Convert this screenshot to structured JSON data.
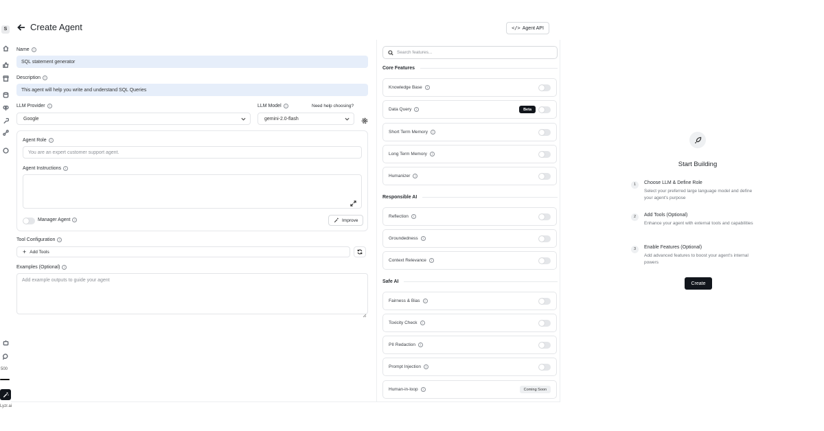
{
  "rail": {
    "logo": "S",
    "credits": "500",
    "brand": "Lyzr.ai"
  },
  "header": {
    "title": "Create Agent",
    "api_button": "Agent API",
    "api_icon": "</>"
  },
  "form": {
    "name_label": "Name",
    "name_value": "SQL statement generator",
    "description_label": "Description",
    "description_value": "This agent will help you write and understand SQL Queries",
    "provider_label": "LLM Provider",
    "provider_value": "Google",
    "model_label": "LLM Model",
    "model_value": "gemini-2.0-flash",
    "help_link": "Need help choosing?",
    "role_label": "Agent Role",
    "role_placeholder": "You are an expert customer support agent.",
    "instructions_label": "Agent Instructions",
    "instructions_placeholder": "",
    "manager_label": "Manager Agent",
    "improve_button": "Improve",
    "tool_label": "Tool Configuration",
    "add_tools_button": "Add Tools",
    "examples_label": "Examples (Optional)",
    "examples_placeholder": "Add example outputs to guide your agent"
  },
  "features": {
    "search_placeholder": "Search features...",
    "core_title": "Core Features",
    "core": [
      {
        "label": "Knowledge Base",
        "enabled": false
      },
      {
        "label": "Data Query",
        "badge": "Beta",
        "enabled": false
      },
      {
        "label": "Short Term Memory",
        "enabled": false
      },
      {
        "label": "Long Term Memory",
        "enabled": false
      },
      {
        "label": "Humanizer",
        "enabled": false
      }
    ],
    "responsible_title": "Responsible AI",
    "responsible": [
      {
        "label": "Reflection",
        "enabled": false
      },
      {
        "label": "Groundedness",
        "enabled": false
      },
      {
        "label": "Context Relevance",
        "enabled": false
      }
    ],
    "safe_title": "Safe AI",
    "safe": [
      {
        "label": "Fairness & Bias",
        "enabled": false
      },
      {
        "label": "Toxicity Check",
        "enabled": false
      },
      {
        "label": "PII Redaction",
        "enabled": false
      },
      {
        "label": "Prompt Injection",
        "enabled": false
      },
      {
        "label": "Human-in-loop",
        "badge": "Coming Soon"
      }
    ]
  },
  "start": {
    "title": "Start Building",
    "steps": [
      {
        "num": "1",
        "title": "Choose LLM & Define Role",
        "desc": "Select your preferred large language model and define your agent's purpose"
      },
      {
        "num": "2",
        "title": "Add Tools (Optional)",
        "desc": "Enhance your agent with external tools and capabilities"
      },
      {
        "num": "3",
        "title": "Enable Features (Optional)",
        "desc": "Add advanced features to boost your agent's internal powers"
      }
    ],
    "create_button": "Create"
  },
  "colors": {
    "primary_dark": "#12161c",
    "input_highlight": "#e6eefa",
    "border": "#e4e6e9"
  }
}
